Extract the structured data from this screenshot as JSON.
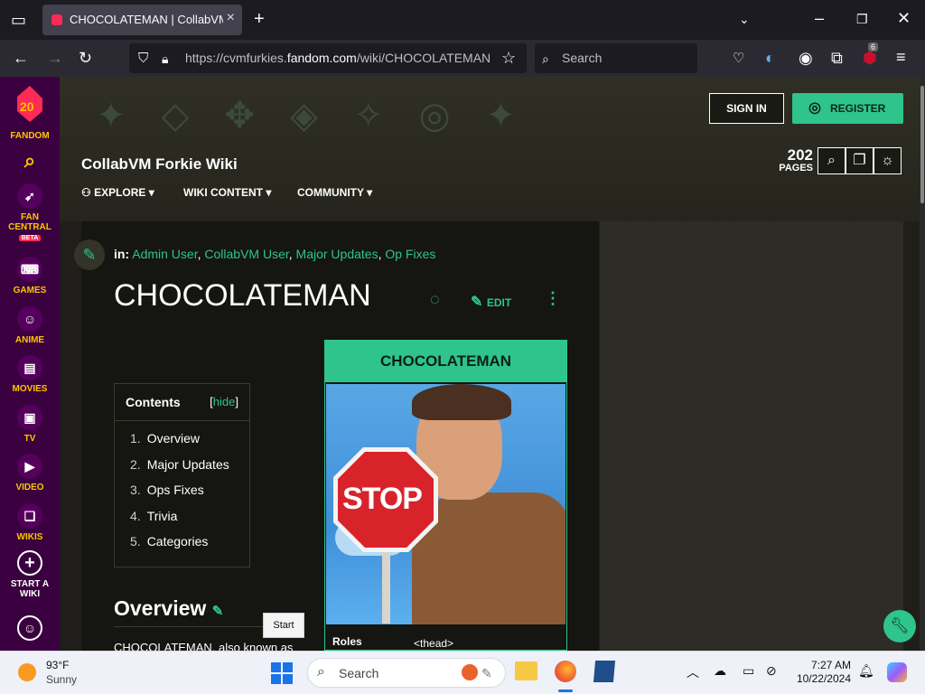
{
  "browser": {
    "tab_title": "CHOCOLATEMAN | CollabVM F",
    "url_prefix": "https://cvmfurkies.",
    "url_domain": "fandom.com",
    "url_path": "/wiki/CHOCOLATEMAN",
    "search_placeholder": "Search",
    "extension_badge": "6"
  },
  "fandom_sidebar": {
    "logo_number": "20",
    "logo_label": "FANDOM",
    "items": [
      {
        "label": "FAN CENTRAL",
        "badge": "BETA"
      },
      {
        "label": "GAMES"
      },
      {
        "label": "ANIME"
      },
      {
        "label": "MOVIES"
      },
      {
        "label": "TV"
      },
      {
        "label": "VIDEO"
      },
      {
        "label": "WIKIS"
      },
      {
        "label": "START A WIKI"
      }
    ]
  },
  "header": {
    "wiki_name": "CollabVM Forkie Wiki",
    "nav": [
      "EXPLORE",
      "WIKI CONTENT",
      "COMMUNITY"
    ],
    "sign_in": "SIGN IN",
    "register": "REGISTER",
    "page_count": "202",
    "page_count_label": "PAGES"
  },
  "article": {
    "categories_prefix": "in:",
    "categories": [
      "Admin User",
      "CollabVM User",
      "Major Updates",
      "Op Fixes"
    ],
    "title": "CHOCOLATEMAN",
    "edit_label": "EDIT",
    "toc": {
      "heading": "Contents",
      "hide_label": "hide",
      "items": [
        {
          "num": "1.",
          "label": "Overview"
        },
        {
          "num": "2.",
          "label": "Major Updates"
        },
        {
          "num": "3.",
          "label": "Ops Fixes"
        },
        {
          "num": "4.",
          "label": "Trivia"
        },
        {
          "num": "5.",
          "label": "Categories"
        }
      ]
    },
    "overview_heading": "Overview",
    "overview_text": "CHOCOLATEMAN, also known as",
    "infobox": {
      "title": "CHOCOLATEMAN",
      "image_sign_text": "STOP",
      "row_label": "Roles",
      "row_value": "<thead>"
    }
  },
  "tooltip": "Start",
  "taskbar": {
    "temperature": "93°F",
    "condition": "Sunny",
    "search_placeholder": "Search",
    "time": "7:27 AM",
    "date": "10/22/2024"
  },
  "colors": {
    "accent": "#2ec48c",
    "fandom_purple": "#3a003f",
    "fandom_yellow": "#ffc500"
  }
}
